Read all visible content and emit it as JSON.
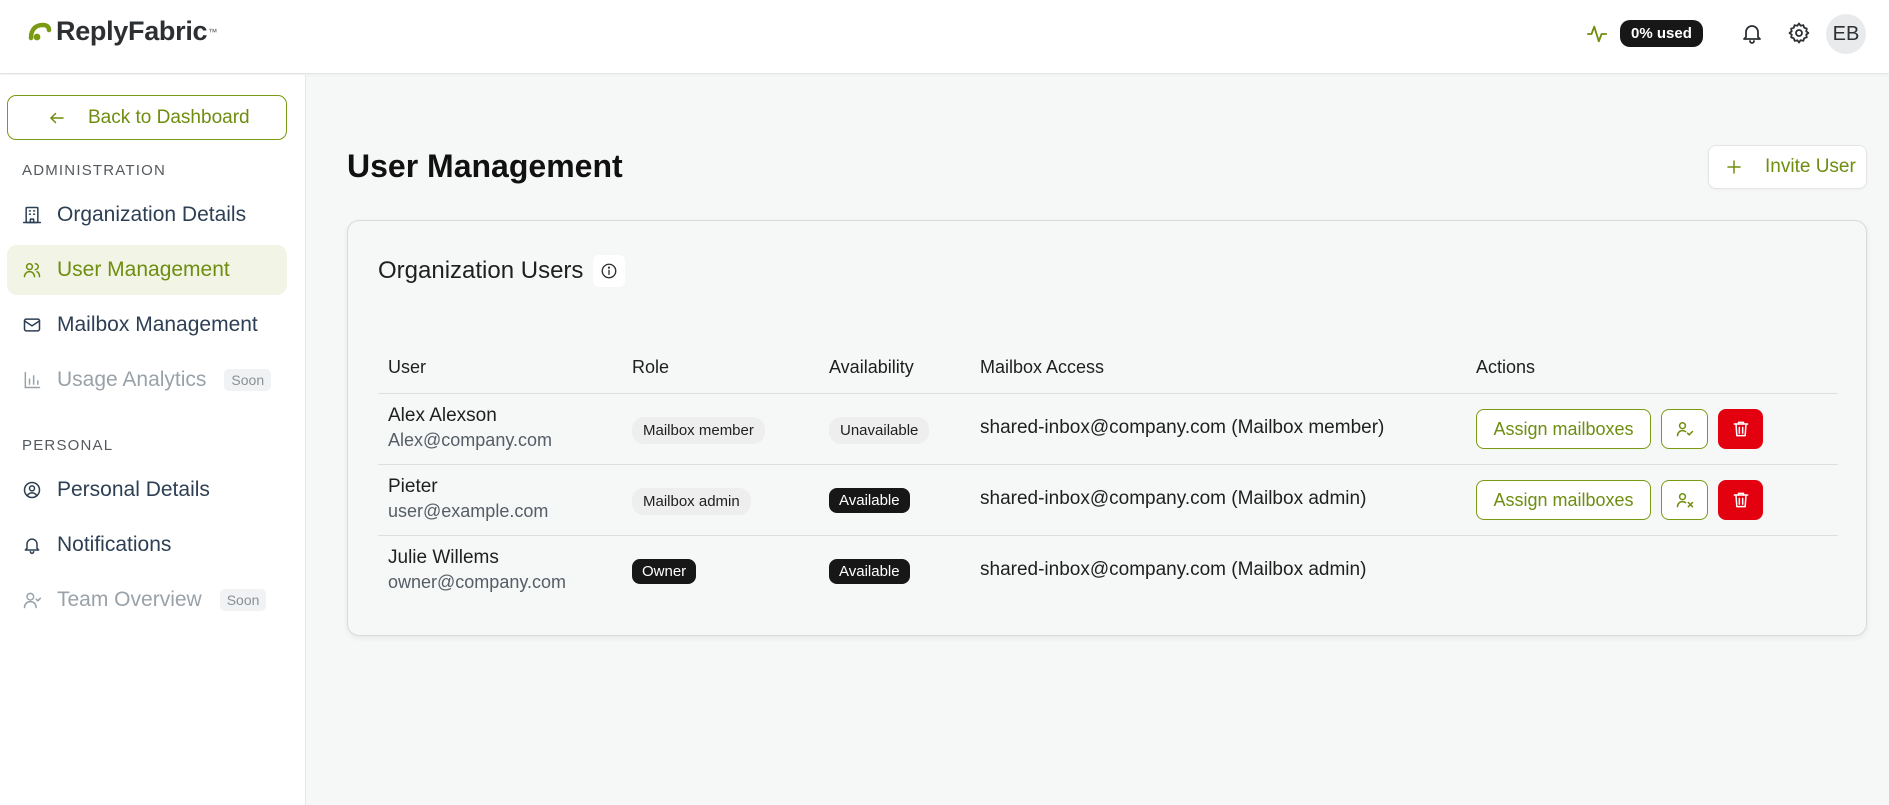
{
  "app": {
    "name": "ReplyFabric",
    "tm": "™"
  },
  "header": {
    "usage_label": "0% used",
    "avatar_initials": "EB"
  },
  "sidebar": {
    "back_label": "Back to Dashboard",
    "sections": [
      {
        "title": "ADMINISTRATION",
        "items": [
          {
            "label": "Organization Details",
            "icon": "building-icon",
            "state": "normal"
          },
          {
            "label": "User Management",
            "icon": "users-icon",
            "state": "active"
          },
          {
            "label": "Mailbox Management",
            "icon": "mail-icon",
            "state": "normal"
          },
          {
            "label": "Usage Analytics",
            "icon": "bar-chart-icon",
            "state": "disabled",
            "badge": "Soon"
          }
        ]
      },
      {
        "title": "PERSONAL",
        "items": [
          {
            "label": "Personal Details",
            "icon": "user-circle-icon",
            "state": "normal"
          },
          {
            "label": "Notifications",
            "icon": "bell-icon",
            "state": "normal"
          },
          {
            "label": "Team Overview",
            "icon": "team-icon",
            "state": "disabled",
            "badge": "Soon"
          }
        ]
      }
    ]
  },
  "main": {
    "title": "User Management",
    "invite_label": "Invite User",
    "card_title": "Organization Users",
    "columns": [
      "User",
      "Role",
      "Availability",
      "Mailbox Access",
      "Actions"
    ],
    "rows": [
      {
        "name": "Alex Alexson",
        "email": "Alex@company.com",
        "role": "Mailbox member",
        "availability": "Unavailable",
        "access": "shared-inbox@company.com (Mailbox member)",
        "assign_label": "Assign mailboxes",
        "has_actions": true,
        "role_style": "light",
        "avail_style": "light"
      },
      {
        "name": "Pieter",
        "email": "user@example.com",
        "role": "Mailbox admin",
        "availability": "Available",
        "access": "shared-inbox@company.com (Mailbox admin)",
        "assign_label": "Assign mailboxes",
        "has_actions": true,
        "role_style": "light",
        "avail_style": "dark"
      },
      {
        "name": "Julie Willems",
        "email": "owner@company.com",
        "role": "Owner",
        "availability": "Available",
        "access": "shared-inbox@company.com (Mailbox admin)",
        "has_actions": false,
        "role_style": "dark",
        "avail_style": "dark"
      }
    ]
  },
  "colors": {
    "accent": "#6f8d0f",
    "danger": "#e3000f",
    "dark_badge": "#171717"
  }
}
